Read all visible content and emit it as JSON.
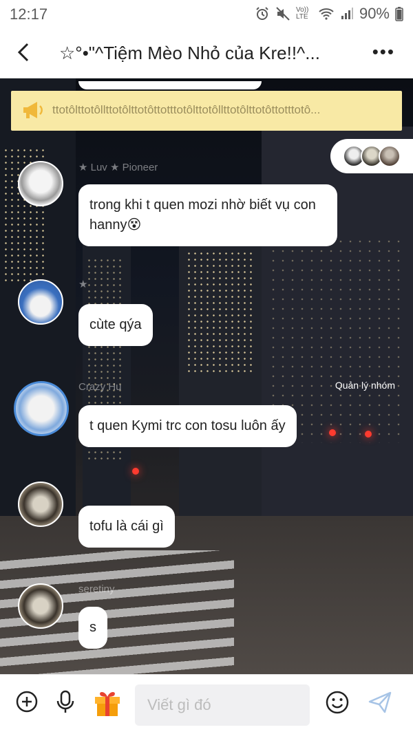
{
  "status_bar": {
    "time": "12:17",
    "battery": "90%",
    "volte": "Vo)) LTE"
  },
  "header": {
    "title": "☆°•\"^Tiệm Mèo Nhỏ của Kre!!^..."
  },
  "announcement": {
    "text": "ttotôlttotôllttotôlttotôttotttotôlttotôllttotôlttotôttotttotô..."
  },
  "messages": [
    {
      "sender": "★ Luv ★ Pioneer",
      "text": "trong khi t quen mozi nhờ biết vụ con hanny😵"
    },
    {
      "sender": "★",
      "text": "cùte qýa"
    },
    {
      "sender": "Crazy Hu",
      "text": "t quen Kymi trc con tosu luôn ấy",
      "tag": "Quản lý nhóm"
    },
    {
      "sender": "",
      "text": "tofu là cái gì"
    },
    {
      "sender": "seretiny",
      "text": "s"
    }
  ],
  "input": {
    "placeholder": "Viết gì đó"
  },
  "icons": [
    "back-arrow-icon",
    "more-icon",
    "megaphone-icon",
    "plus-icon",
    "microphone-icon",
    "gift-icon",
    "emoji-icon",
    "send-icon"
  ],
  "colors": {
    "announce_bg": "#f8e9a5",
    "announce_text": "#9a8d5c",
    "send": "#a7c4e6"
  }
}
